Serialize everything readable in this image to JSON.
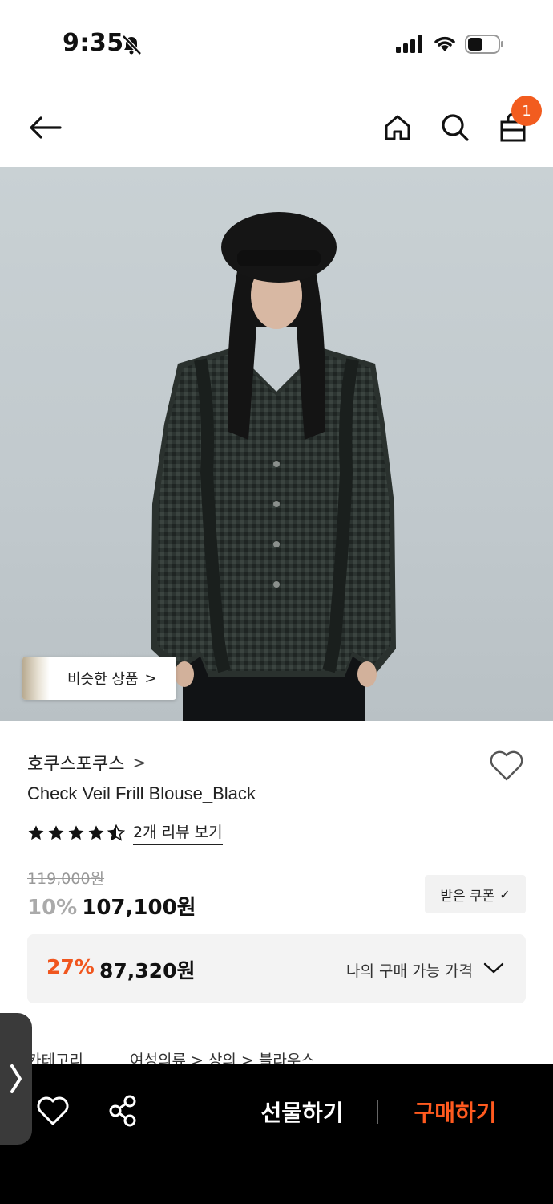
{
  "status_bar": {
    "time": "9:35"
  },
  "nav": {
    "cart_badge": "1"
  },
  "image": {
    "similar_button_label": "비슷한 상품",
    "similar_chevron": ">"
  },
  "product": {
    "brand": "호쿠스포쿠스",
    "brand_chevron": ">",
    "title": "Check Veil Frill Blouse_Black",
    "rating_stars": 4.5,
    "review_link": "2개 리뷰 보기",
    "original_price": "119,000원",
    "discount": "10%",
    "sale_price": "107,100원",
    "coupon_label": "받은 쿠폰",
    "coupon_check": "✓"
  },
  "my_price": {
    "percent": "27%",
    "price": "87,320원",
    "label": "나의 구매 가능 가격"
  },
  "category": {
    "label": "카테고리",
    "path": "여성의류  >  상의  >  블라우스"
  },
  "bottom_bar": {
    "gift_label": "선물하기",
    "buy_label": "구매하기"
  },
  "colors": {
    "accent": "#f25c1f",
    "buy": "#ff5a1f",
    "bottom_bg": "#000000"
  }
}
